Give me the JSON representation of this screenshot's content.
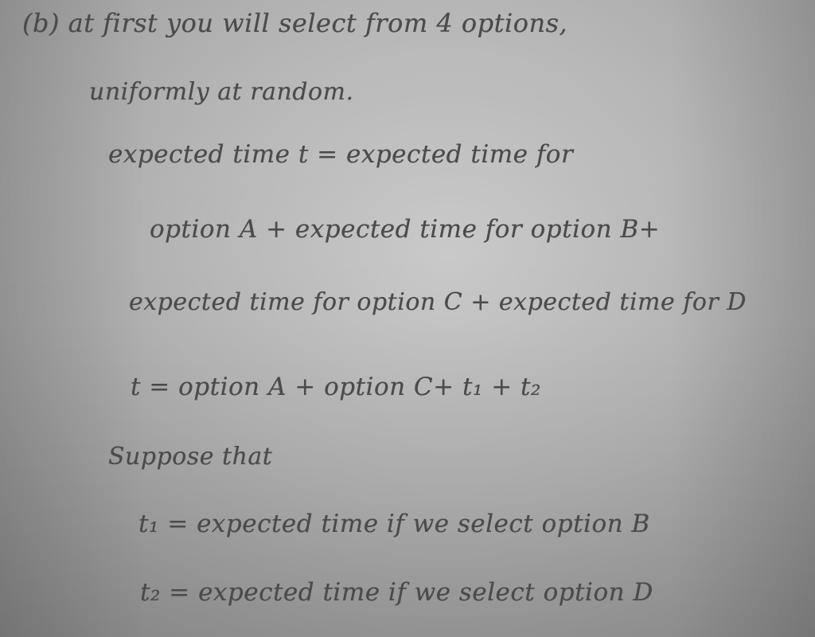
{
  "notes": {
    "lines": [
      "(b) at   first  you  will  select  from  4 options,",
      "uniformly   at    random.",
      "expected  time   t =  expected time  for",
      "option A + expected time for option B+",
      "expected time for option C + expected time for D",
      "t = option A + option C+  t₁ + t₂",
      "Suppose   that",
      "t₁  =  expected  time   if we select option B",
      "t₂ =  expected  time   if we select option D"
    ]
  }
}
